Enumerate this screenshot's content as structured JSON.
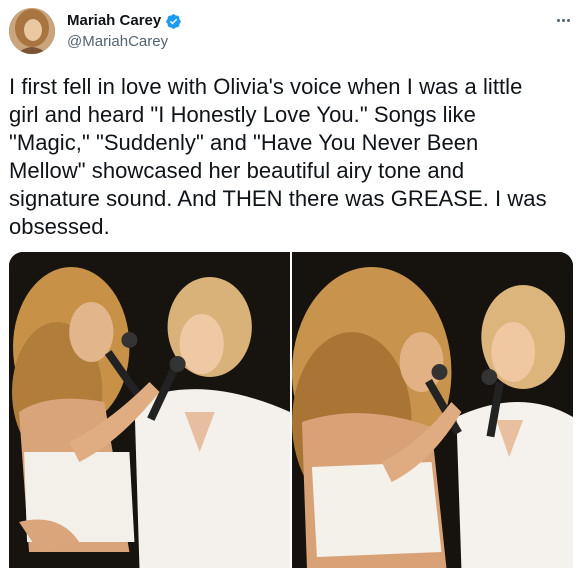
{
  "tweet": {
    "author": {
      "display_name": "Mariah Carey",
      "handle": "@MariahCarey",
      "verified": true,
      "avatar_icon": "avatar-photo"
    },
    "text": "I first fell in love with Olivia's voice when I was a little\ngirl and heard \"I Honestly Love You.\" Songs like\n\"Magic,\" \"Suddenly\" and \"Have You Never Been\nMellow\" showcased her beautiful airy tone and\nsignature sound. And THEN there was GREASE. I was\nobsessed.",
    "media": [
      {
        "type": "photo",
        "description_icon": "concert-photo"
      },
      {
        "type": "photo",
        "description_icon": "concert-photo"
      }
    ],
    "more_icon": "more-horizontal-icon"
  },
  "colors": {
    "text_primary": "#0f1419",
    "text_secondary": "#536471",
    "verified_blue": "#1d9bf0"
  }
}
